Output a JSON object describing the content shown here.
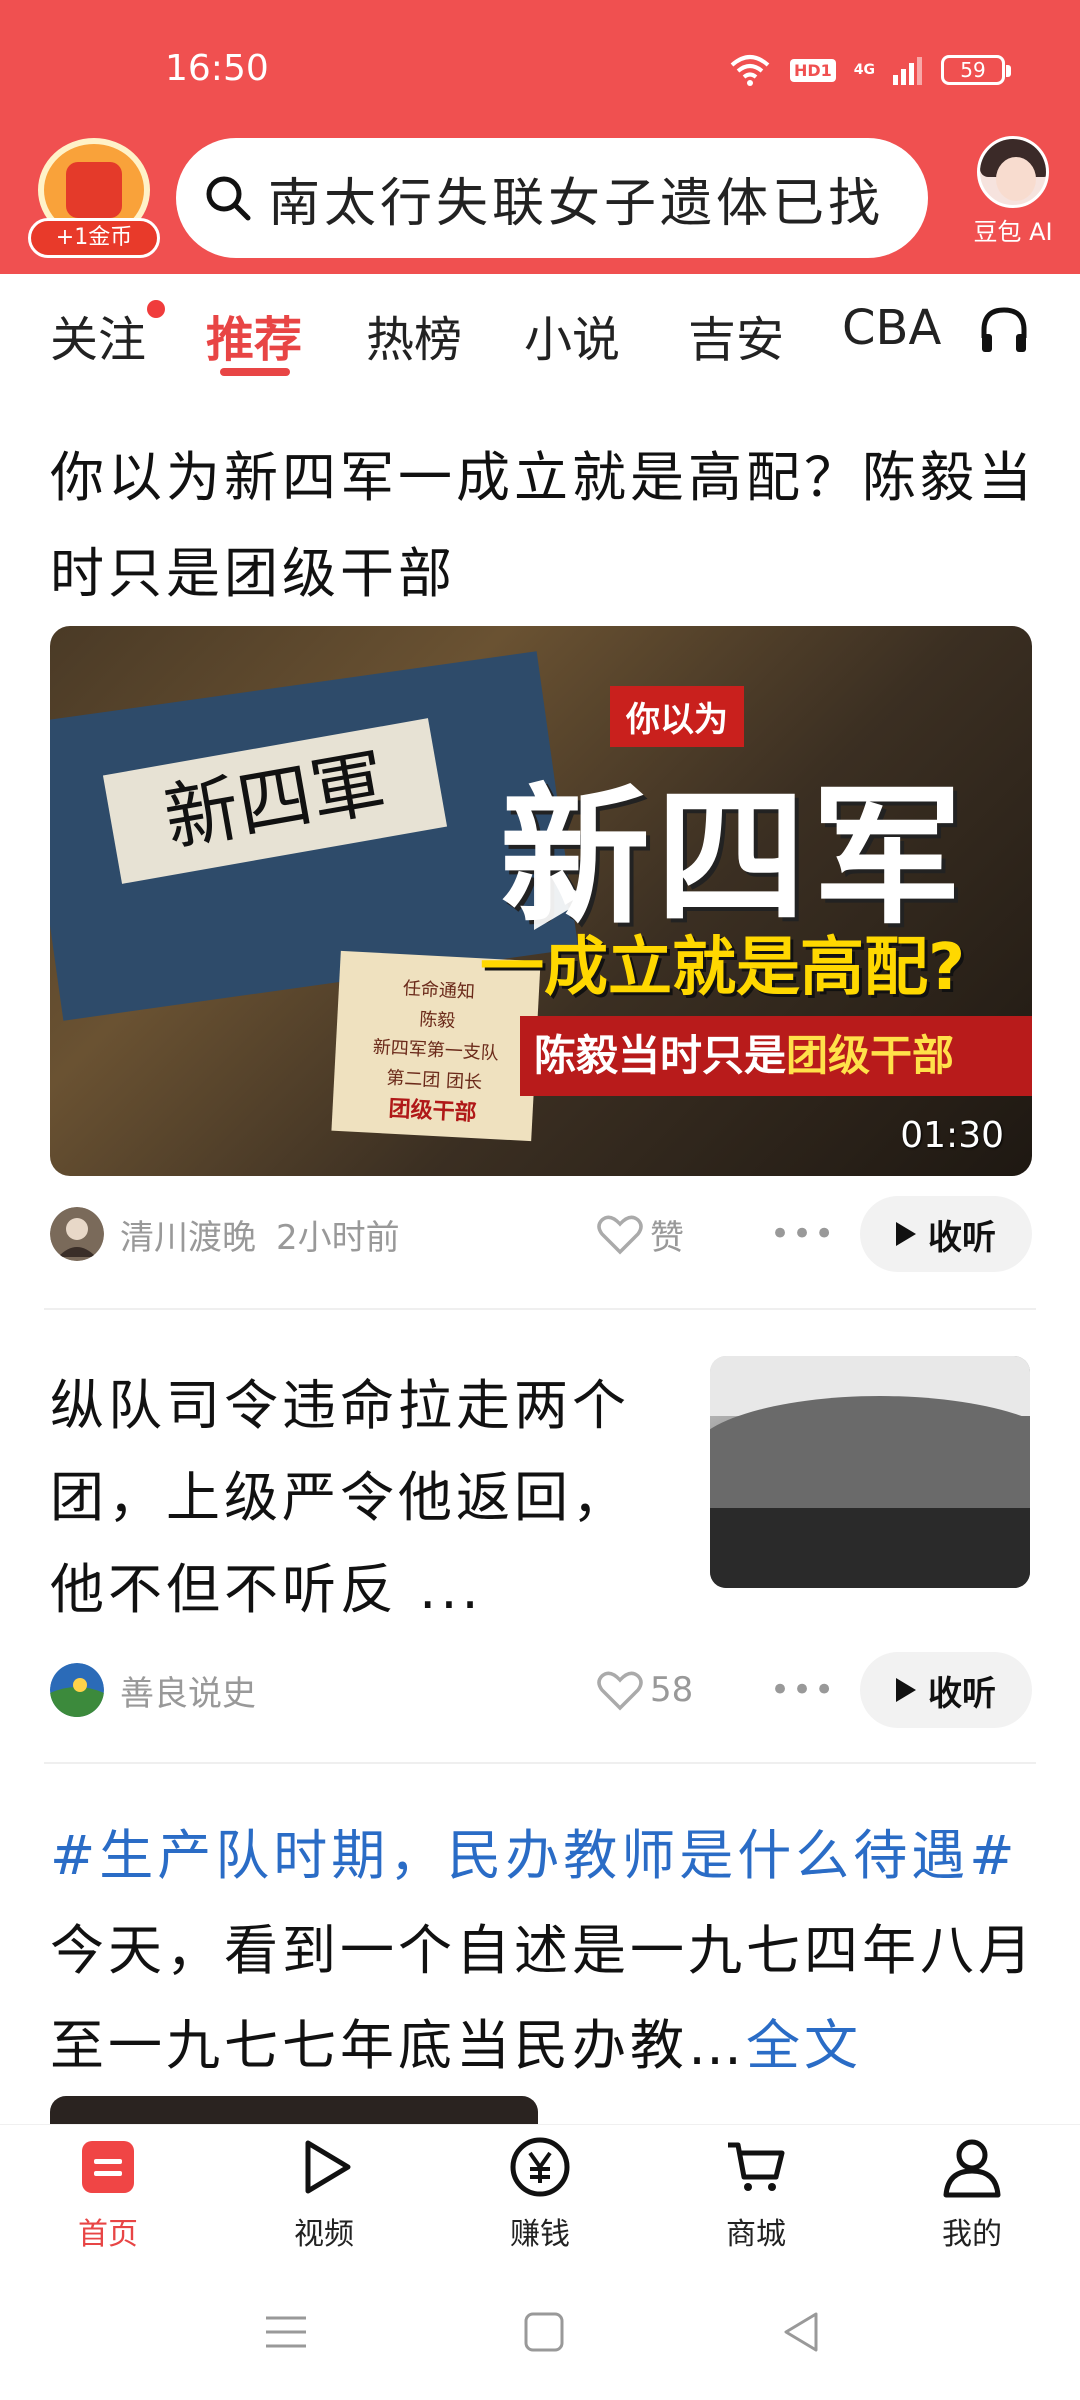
{
  "status_bar": {
    "time": "16:50",
    "hd_label": "HD1",
    "network": "4G",
    "battery": "59"
  },
  "header": {
    "coin_label": "+1金币",
    "search_text": "南太行失联女子遗体已找",
    "ai_label": "豆包 AI"
  },
  "tabs": [
    {
      "label": "关注",
      "has_dot": true
    },
    {
      "label": "推荐",
      "active": true
    },
    {
      "label": "热榜"
    },
    {
      "label": "小说"
    },
    {
      "label": "吉安"
    },
    {
      "label": "CBA"
    }
  ],
  "article1": {
    "title": "你以为新四军一成立就是高配？陈毅当时只是团级干部",
    "image": {
      "badge": "你以为",
      "headline": "新四军",
      "subheadline": "一成立就是高配?",
      "banner_prefix": "陈毅当时只是",
      "banner_highlight": "团级干部",
      "flag_text": "新四軍",
      "note_title": "任命通知",
      "note_name": "陈毅",
      "note_line1": "新四军第一支队",
      "note_line2": "第二团 团长",
      "note_red": "团级干部",
      "duration": "01:30"
    },
    "author": "清川渡晚",
    "time_ago": "2小时前",
    "like_label": "赞",
    "listen_label": "收听"
  },
  "article2": {
    "title": "纵队司令违命拉走两个团，上级严令他返回，他不但不听反 ...",
    "author": "善良说史",
    "likes": "58",
    "listen_label": "收听"
  },
  "article3": {
    "tag": "#生产队时期，民办教师是什么待遇#",
    "body": "今天，看到一个自述是一九七四年八月至一九七七年底当民办教…",
    "more": "全文"
  },
  "bottom_nav": [
    {
      "label": "首页",
      "icon": "home-icon",
      "active": true
    },
    {
      "label": "视频",
      "icon": "video-icon"
    },
    {
      "label": "赚钱",
      "icon": "yuan-icon"
    },
    {
      "label": "商城",
      "icon": "cart-icon"
    },
    {
      "label": "我的",
      "icon": "profile-icon"
    }
  ],
  "colors": {
    "brand_red": "#f05050",
    "link_blue": "#2a6cc6",
    "muted": "#999999"
  }
}
